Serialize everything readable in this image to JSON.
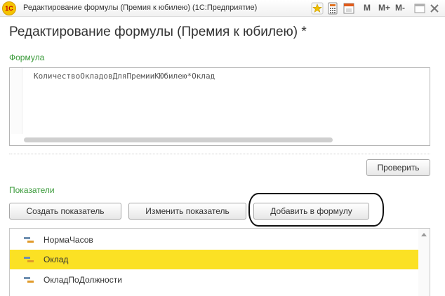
{
  "window": {
    "app_icon_text": "1С",
    "title": "Редактирование формулы (Премия к юбилею)  (1С:Предприятие)",
    "toolbar": {
      "m_label": "M",
      "m_plus_label": "M+",
      "m_minus_label": "M-"
    }
  },
  "form": {
    "title": "Редактирование формулы (Премия к юбилею) *",
    "formula_label": "Формула",
    "formula_text": "КоличествоОкладовДляПремииКЮбилею*Оклад",
    "check_button": "Проверить",
    "indicators_label": "Показатели",
    "buttons": {
      "create": "Создать показатель",
      "edit": "Изменить показатель",
      "add_to_formula": "Добавить в формулу"
    },
    "indicators": [
      {
        "label": "НормаЧасов",
        "selected": false
      },
      {
        "label": "Оклад",
        "selected": true
      },
      {
        "label": "ОкладПоДолжности",
        "selected": false
      }
    ]
  },
  "colors": {
    "accent_green": "#3a9a3a",
    "selection_yellow": "#fbe124"
  }
}
